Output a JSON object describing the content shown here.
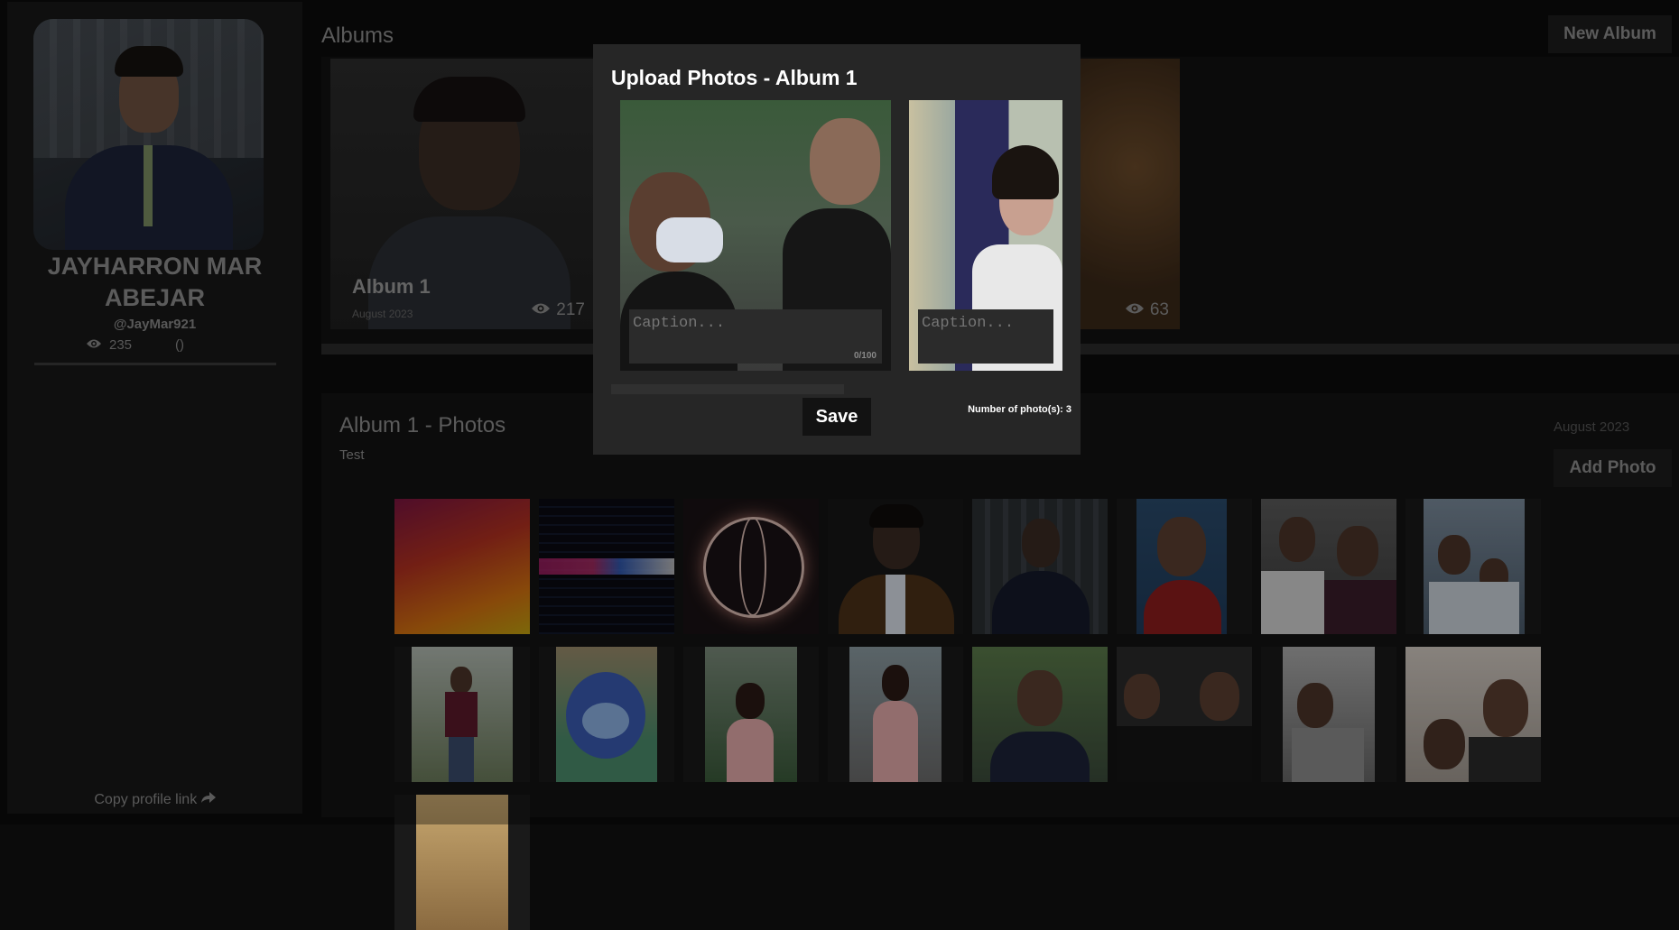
{
  "profile": {
    "name": "JAYHARRON MAR ABEJAR",
    "handle": "@JayMar921",
    "views": "235",
    "parens": "()",
    "copy_link": "Copy profile link"
  },
  "albums": {
    "title": "Albums",
    "new_album_label": "New Album",
    "cards": [
      {
        "title": "Album 1",
        "date": "August 2023",
        "views": "217"
      },
      {
        "title": "",
        "date": "",
        "views": "63"
      }
    ]
  },
  "photos_section": {
    "title": "Album 1 - Photos",
    "description": "Test",
    "date": "August 2023",
    "add_photo_label": "Add Photo"
  },
  "modal": {
    "title": "Upload Photos - Album 1",
    "caption_placeholder": "Caption...",
    "char_count": "0/100",
    "save_label": "Save",
    "photo_count": "Number of photo(s): 3"
  },
  "colors": {
    "background": "#0b0b0b",
    "sidebar": "#171717",
    "modal": "#262626",
    "text_muted": "#8c8c8c"
  }
}
